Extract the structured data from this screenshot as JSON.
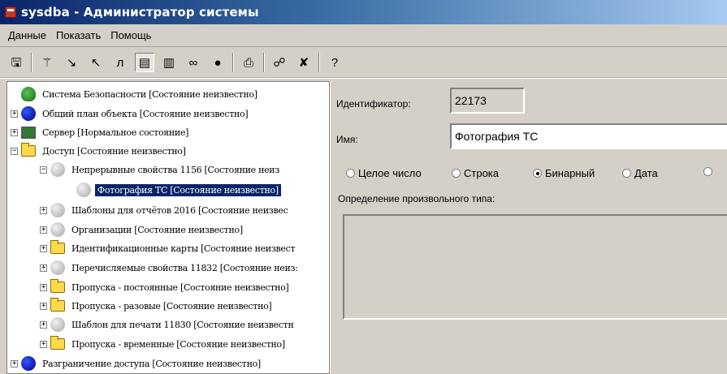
{
  "window": {
    "title": "sysdba - Администратор системы"
  },
  "menu": [
    "Данные",
    "Показать",
    "Помощь"
  ],
  "toolbar": {
    "buttons": [
      {
        "name": "save-icon",
        "glyph": "🖫"
      },
      {
        "name": "wand-icon",
        "glyph": "⚚"
      },
      {
        "name": "arrow-down-right-icon",
        "glyph": "↘"
      },
      {
        "name": "arrow-up-left-icon",
        "glyph": "↖"
      },
      {
        "name": "lambda-icon",
        "glyph": "л"
      },
      {
        "name": "properties-icon",
        "glyph": "▤"
      },
      {
        "name": "columns-icon",
        "glyph": "▥"
      },
      {
        "name": "glasses-icon",
        "glyph": "∞"
      },
      {
        "name": "globe-icon",
        "glyph": "●"
      },
      {
        "name": "print-icon",
        "glyph": "⎙"
      },
      {
        "name": "connect-icon",
        "glyph": "☍"
      },
      {
        "name": "delete-icon",
        "glyph": "✘"
      },
      {
        "name": "help-icon",
        "glyph": "?"
      }
    ]
  },
  "tree": {
    "nodes": [
      {
        "label": "Система Безопасности [Состояние неизвестно]",
        "icon": "globe",
        "expander": ""
      },
      {
        "label": "Общий план объекта [Состояние неизвестно]",
        "icon": "blue",
        "expander": "+"
      },
      {
        "label": "Сервер [Нормальное состояние]",
        "icon": "monitor",
        "expander": "+"
      },
      {
        "label": "Доступ [Состояние неизвестно]",
        "icon": "folder",
        "expander": "−"
      },
      {
        "label": "Непрерывные свойства 1156 [Состояние неиз",
        "icon": "grey",
        "expander": "−"
      },
      {
        "label": "Фотография ТС [Состояние неизвестно]",
        "icon": "grey",
        "expander": "",
        "selected": true
      },
      {
        "label": "Шаблоны для отчётов 2016 [Состояние неизвес",
        "icon": "grey",
        "expander": "+"
      },
      {
        "label": "Организации [Состояние неизвестно]",
        "icon": "grey",
        "expander": "+"
      },
      {
        "label": "Идентификационные карты [Состояние неизвест",
        "icon": "folder",
        "expander": "+"
      },
      {
        "label": "Перечисляемые свойства 11832 [Состояние неиз:",
        "icon": "grey",
        "expander": "+"
      },
      {
        "label": "Пропуска - постоянные [Состояние неизвестно]",
        "icon": "folder",
        "expander": "+"
      },
      {
        "label": "Пропуска - разовые [Состояние неизвестно]",
        "icon": "folder",
        "expander": "+"
      },
      {
        "label": "Шаблон для печати 11830 [Состояние неизвестн",
        "icon": "grey",
        "expander": "+"
      },
      {
        "label": "Пропуска - временные [Состояние неизвестно]",
        "icon": "folder",
        "expander": "+"
      },
      {
        "label": "Разграничение доступа [Состояние неизвестно]",
        "icon": "blue",
        "expander": "+"
      }
    ]
  },
  "details": {
    "id_label": "Идентификатор:",
    "id_value": "22173",
    "name_label": "Имя:",
    "name_value": "Фотография ТС",
    "type_options": [
      {
        "label": "Целое число",
        "checked": false
      },
      {
        "label": "Строка",
        "checked": false
      },
      {
        "label": "Бинарный",
        "checked": true
      },
      {
        "label": "Дата",
        "checked": false
      },
      {
        "label": "",
        "checked": false
      }
    ],
    "custom_type_label": "Определение произвольного типа:"
  }
}
